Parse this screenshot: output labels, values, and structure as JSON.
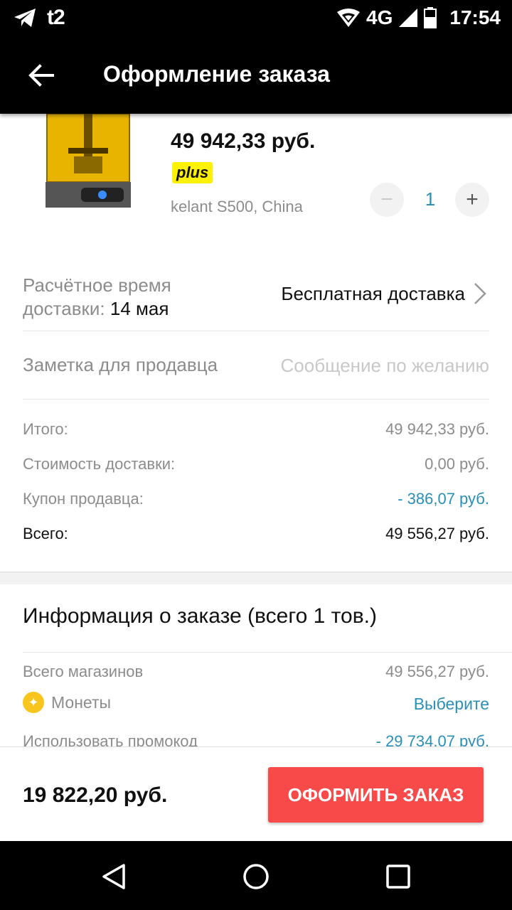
{
  "status_bar": {
    "carrier": "t2",
    "network": "4G",
    "time": "17:54"
  },
  "app_bar": {
    "title": "Оформление заказа"
  },
  "product": {
    "price": "49 942,33 руб.",
    "badge": "plus",
    "variant": "kelant S500, China",
    "quantity": "1",
    "minus_label": "−",
    "plus_label": "+"
  },
  "delivery": {
    "label": "Расчётное время",
    "label_line2": "доставки:",
    "date": "14 мая",
    "value": "Бесплатная доставка"
  },
  "seller_note": {
    "label": "Заметка для продавца",
    "placeholder": "Сообщение по желанию"
  },
  "summary": {
    "rows": [
      {
        "label": "Итого:",
        "value": "49 942,33 руб."
      },
      {
        "label": "Стоимость доставки:",
        "value": "0,00 руб."
      },
      {
        "label": "Купон продавца:",
        "value": "- 386,07 руб."
      },
      {
        "label": "Всего:",
        "value": "49 556,27 руб."
      }
    ]
  },
  "order_info": {
    "title": "Информация о заказе (всего 1 тов.)",
    "rows": [
      {
        "label": "Всего магазинов",
        "value": "49 556,27 руб."
      },
      {
        "label": "Монеты",
        "value": "Выберите"
      },
      {
        "label": "Использовать промокод",
        "value": "- 29 734,07 руб."
      }
    ]
  },
  "bottom_bar": {
    "total": "19 822,20 руб.",
    "order_button": "ОФОРМИТЬ ЗАКАЗ"
  },
  "colors": {
    "accent_red": "#f94a4a",
    "link_blue": "#2a8fb8",
    "plus_yellow": "#fff200",
    "coin_yellow": "#f7c51e"
  },
  "icons": [
    "telegram-icon",
    "wifi-icon",
    "signal-icon",
    "battery-icon",
    "back-arrow-icon",
    "chevron-right-icon",
    "coin-icon",
    "nav-back-icon",
    "nav-home-icon",
    "nav-recents-icon"
  ]
}
